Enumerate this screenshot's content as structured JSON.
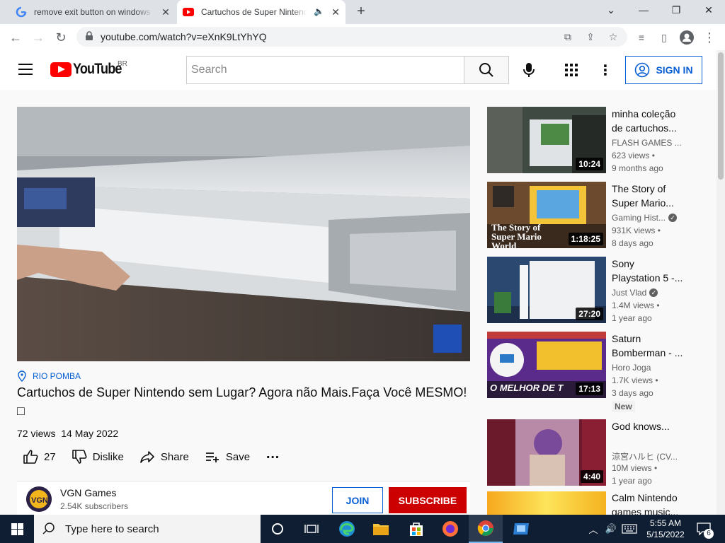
{
  "browser": {
    "tabs": [
      {
        "title": "remove exit button on windows 7",
        "favicon": "google-g-icon"
      },
      {
        "title": "Cartuchos de Super Nintendo sem Lugar? Agora não Mais",
        "favicon": "youtube-icon",
        "active": true
      }
    ],
    "new_tab": "+",
    "url": "youtube.com/watch?v=eXnK9LtYhYQ"
  },
  "youtube": {
    "logo_text": "YouTube",
    "country_code": "BR",
    "search_placeholder": "Search",
    "sign_in": "SIGN IN",
    "video": {
      "location": "RIO POMBA",
      "title": "Cartuchos de Super Nintendo sem Lugar? Agora não Mais.Faça Você MESMO!□",
      "views": "72 views",
      "date": "14 May 2022",
      "likes": "27",
      "dislike": "Dislike",
      "share": "Share",
      "save": "Save"
    },
    "channel": {
      "name": "VGN Games",
      "subscribers": "2.54K subscribers",
      "join": "JOIN",
      "subscribe": "SUBSCRIBE"
    },
    "recommendations": [
      {
        "title": "minha coleção de cartuchos...",
        "channel": "FLASH GAMES ...",
        "views": "623 views •",
        "age": "9 months ago",
        "duration": "10:24",
        "verified": false
      },
      {
        "title": "The Story of Super Mario...",
        "channel": "Gaming Hist...",
        "views": "931K views •",
        "age": "8 days ago",
        "duration": "1:18:25",
        "verified": true,
        "thumb_text": "The Story of Super Mario World"
      },
      {
        "title": "Sony Playstation 5 -...",
        "channel": "Just Vlad",
        "views": "1.4M views •",
        "age": "1 year ago",
        "duration": "27:20",
        "verified": true
      },
      {
        "title": "Saturn Bomberman - ...",
        "channel": "Horo Joga",
        "views": "1.7K views •",
        "age": "3 days ago",
        "duration": "17:13",
        "verified": false,
        "badge": "New",
        "thumb_text": "O MELHOR DE T"
      },
      {
        "title": "God knows...",
        "channel": "涼宮ハルヒ (CV...",
        "views": "10M views •",
        "age": "1 year ago",
        "duration": "4:40",
        "verified": false
      },
      {
        "title": "Calm Nintendo games music...",
        "channel": "",
        "views": "",
        "age": "",
        "duration": "",
        "verified": false
      }
    ]
  },
  "taskbar": {
    "search_placeholder": "Type here to search",
    "time": "5:55 AM",
    "date": "5/15/2022",
    "notifications": "6"
  }
}
